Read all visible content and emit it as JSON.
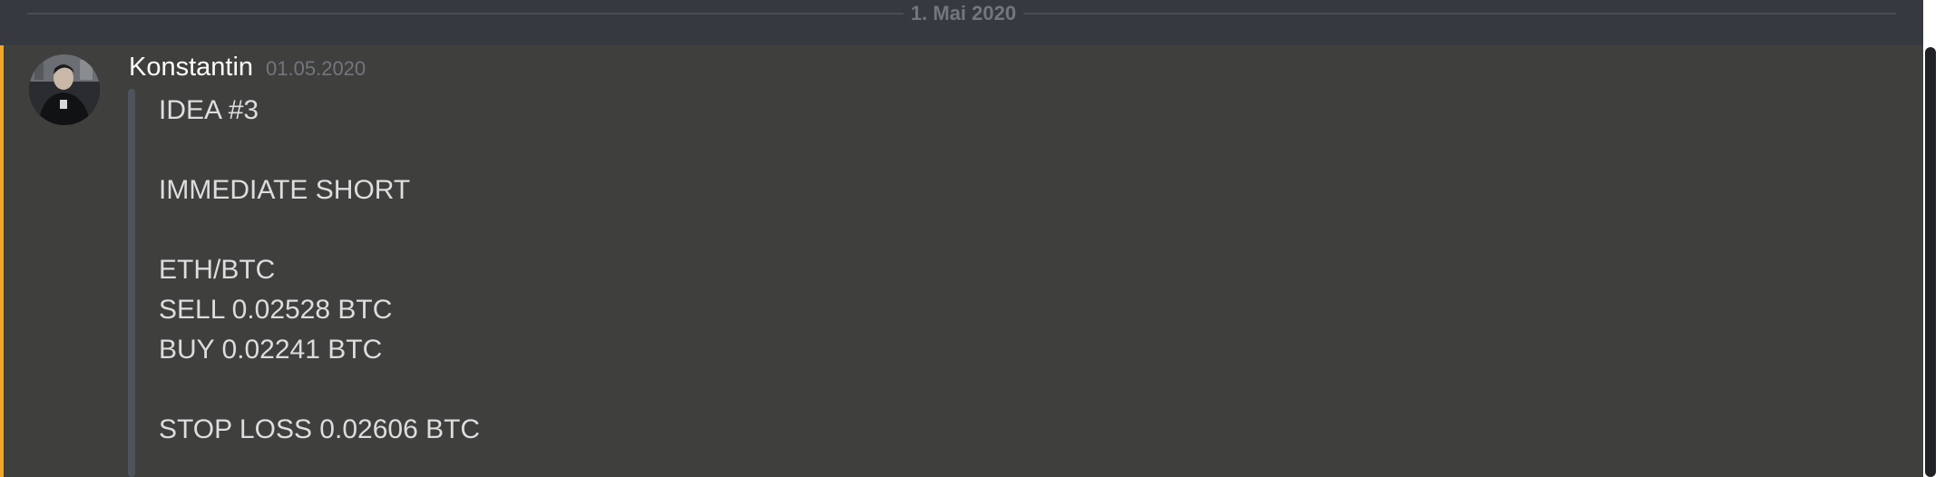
{
  "divider": {
    "date": "1. Mai 2020"
  },
  "message": {
    "author": "Konstantin",
    "timestamp": "01.05.2020",
    "lines": [
      "IDEA #3",
      "",
      "IMMEDIATE SHORT",
      "",
      "ETH/BTC",
      "SELL 0.02528 BTC",
      "BUY 0.02241 BTC",
      "",
      "STOP LOSS 0.02606 BTC"
    ]
  },
  "colors": {
    "background": "#3f3f3d",
    "header_background": "#36393f",
    "mention_accent": "#f0a82b",
    "text": "#dcddde",
    "muted": "#72767d",
    "quote_bar": "#4f545c"
  },
  "icons": {
    "avatar": "user-avatar"
  }
}
